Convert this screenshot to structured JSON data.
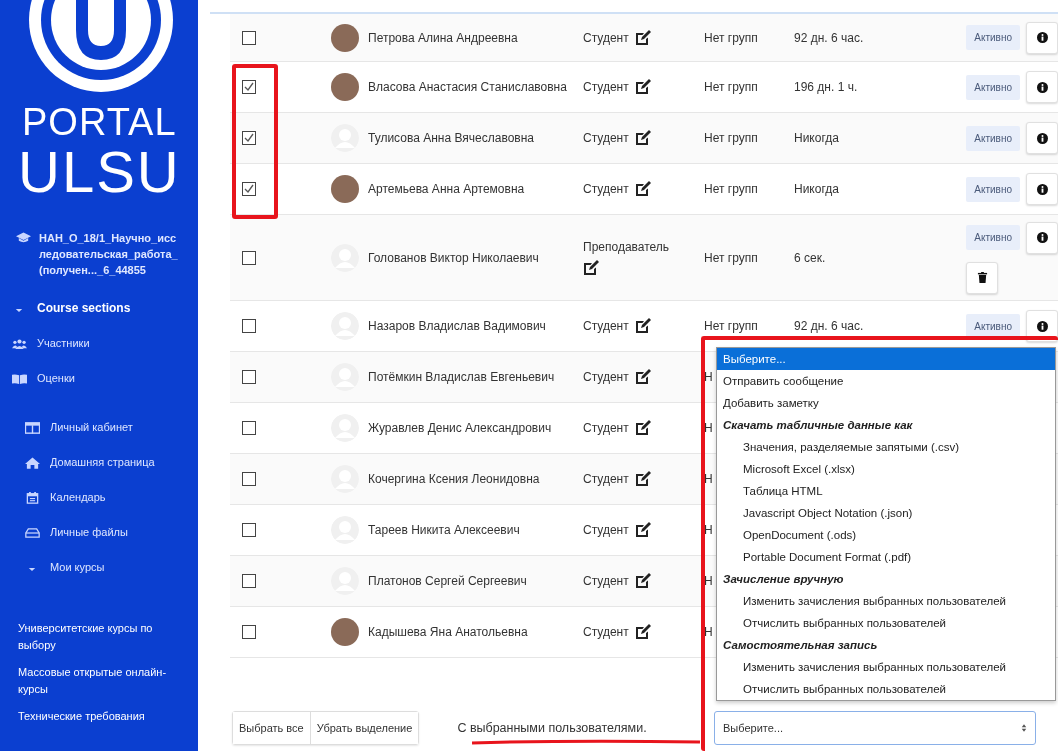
{
  "sidebar": {
    "logo": {
      "line1": "PORTAL",
      "line2": "ULSU"
    },
    "course": {
      "title": "НАН_О_18/1_Научно_исследовательская_работа_(получен..._6_44855"
    },
    "course_nav": [
      "Course sections",
      "Участники",
      "Оценки"
    ],
    "site_nav": [
      "Личный кабинет",
      "Домашняя страница",
      "Календарь",
      "Личные файлы",
      "Мои курсы"
    ],
    "links": [
      "Университетские курсы по выбору",
      "Массовые открытые онлайн-курсы",
      "Технические требования"
    ]
  },
  "participants": [
    {
      "checked": false,
      "kind": "photo",
      "name": "Петрова Алина Андреевна",
      "role": "Студент",
      "groups": "Нет групп",
      "last_access": "92 дн. 6 час.",
      "status": "Активно",
      "can_delete": false
    },
    {
      "checked": true,
      "kind": "photo",
      "name": "Власова Анастасия Станиславовна",
      "role": "Студент",
      "groups": "Нет групп",
      "last_access": "196 дн. 1 ч.",
      "status": "Активно",
      "can_delete": false
    },
    {
      "checked": true,
      "kind": "default",
      "name": "Тулисова Анна Вячеславовна",
      "role": "Студент",
      "groups": "Нет групп",
      "last_access": "Никогда",
      "status": "Активно",
      "can_delete": false
    },
    {
      "checked": true,
      "kind": "photo",
      "name": "Артемьева Анна Артемовна",
      "role": "Студент",
      "groups": "Нет групп",
      "last_access": "Никогда",
      "status": "Активно",
      "can_delete": false
    },
    {
      "checked": false,
      "kind": "default",
      "name": "Голованов Виктор Николаевич",
      "role": "Преподаватель",
      "groups": "Нет групп",
      "last_access": "6 сек.",
      "status": "Активно",
      "can_delete": true
    },
    {
      "checked": false,
      "kind": "default",
      "name": "Назаров Владислав Вадимович",
      "role": "Студент",
      "groups": "Нет групп",
      "last_access": "92 дн. 6 час.",
      "status": "Активно",
      "can_delete": false
    },
    {
      "checked": false,
      "kind": "default",
      "name": "Потёмкин Владислав Евгеньевич",
      "role": "Студент",
      "groups": "Н"
    },
    {
      "checked": false,
      "kind": "default",
      "name": "Журавлев Денис Александрович",
      "role": "Студент",
      "groups": "Н"
    },
    {
      "checked": false,
      "kind": "default",
      "name": "Кочергина Ксения Леонидовна",
      "role": "Студент",
      "groups": "Н"
    },
    {
      "checked": false,
      "kind": "default",
      "name": "Тареев Никита Алексеевич",
      "role": "Студент",
      "groups": "Н"
    },
    {
      "checked": false,
      "kind": "default",
      "name": "Платонов Сергей Сергеевич",
      "role": "Студент",
      "groups": "Н"
    },
    {
      "checked": false,
      "kind": "photo",
      "name": "Кадышева Яна Анатольевна",
      "role": "Студент",
      "groups": "Н"
    }
  ],
  "bulk": {
    "buttons": [
      "Выбрать все",
      "Убрать выделение"
    ],
    "label": "С выбранными пользователями.",
    "select_value": "Выберите...",
    "options": [
      {
        "kind": "option",
        "label": "Выберите...",
        "selected": true
      },
      {
        "kind": "option",
        "label": "Отправить сообщение",
        "selected": false
      },
      {
        "kind": "option",
        "label": "Добавить заметку",
        "selected": false
      },
      {
        "kind": "group",
        "label": "Скачать табличные данные как",
        "selected": false
      },
      {
        "kind": "sub",
        "label": "Значения, разделяемые запятыми (.csv)",
        "selected": false
      },
      {
        "kind": "sub",
        "label": "Microsoft Excel (.xlsx)",
        "selected": false
      },
      {
        "kind": "sub",
        "label": "Таблица HTML",
        "selected": false
      },
      {
        "kind": "sub",
        "label": "Javascript Object Notation (.json)",
        "selected": false
      },
      {
        "kind": "sub",
        "label": "OpenDocument (.ods)",
        "selected": false
      },
      {
        "kind": "sub",
        "label": "Portable Document Format (.pdf)",
        "selected": false
      },
      {
        "kind": "group",
        "label": "Зачисление вручную",
        "selected": false
      },
      {
        "kind": "sub",
        "label": "Изменить зачисления выбранных пользователей",
        "selected": false
      },
      {
        "kind": "sub",
        "label": "Отчислить выбранных пользователей",
        "selected": false
      },
      {
        "kind": "group",
        "label": "Самостоятельная запись",
        "selected": false
      },
      {
        "kind": "sub",
        "label": "Изменить зачисления выбранных пользователей",
        "selected": false
      },
      {
        "kind": "sub",
        "label": "Отчислить выбранных пользователей",
        "selected": false
      }
    ]
  }
}
